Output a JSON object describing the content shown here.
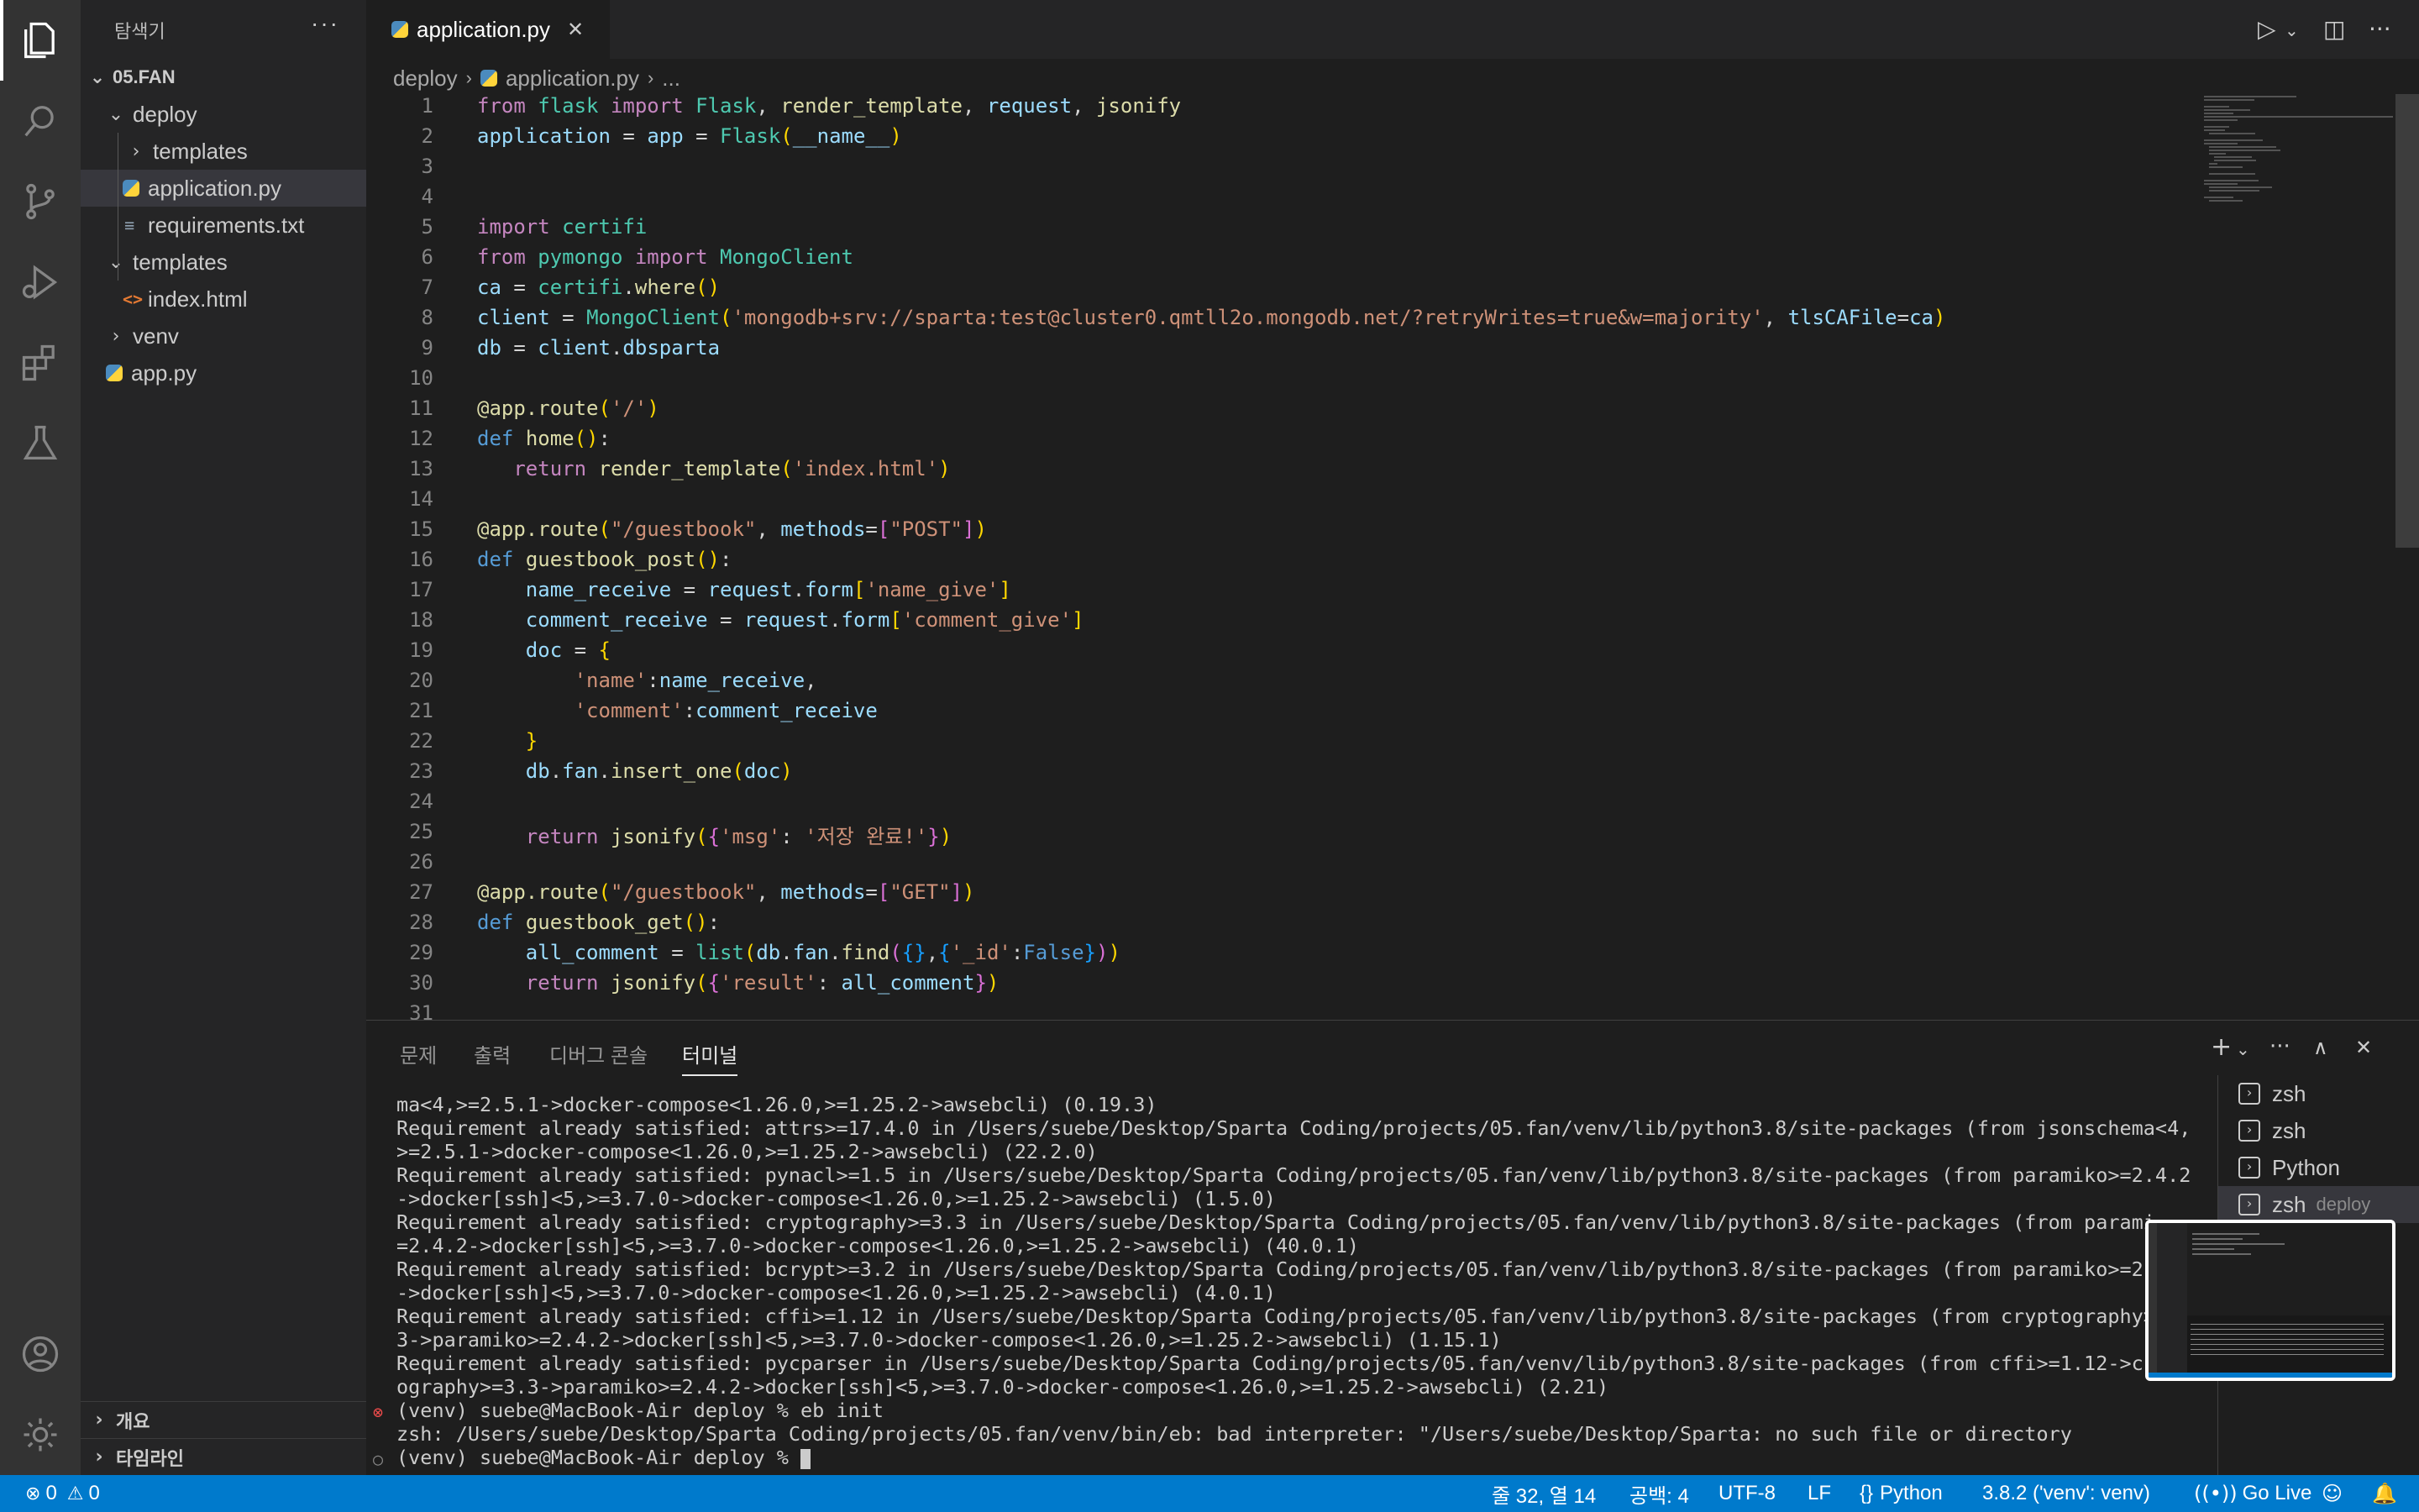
{
  "sidebar": {
    "title": "탐색기",
    "more": "···",
    "root": "05.FAN",
    "items": [
      {
        "label": "deploy"
      },
      {
        "label": "templates"
      },
      {
        "label": "application.py"
      },
      {
        "label": "requirements.txt"
      },
      {
        "label": "templates"
      },
      {
        "label": "index.html"
      },
      {
        "label": "venv"
      },
      {
        "label": "app.py"
      }
    ],
    "outline": "개요",
    "timeline": "타임라인"
  },
  "tab": {
    "label": "application.py",
    "close": "✕"
  },
  "breadcrumb": {
    "folder": "deploy",
    "file": "application.py",
    "ellipsis": "..."
  },
  "editor": {
    "line_numbers": [
      "1",
      "2",
      "3",
      "4",
      "5",
      "6",
      "7",
      "8",
      "9",
      "10",
      "11",
      "12",
      "13",
      "14",
      "15",
      "16",
      "17",
      "18",
      "19",
      "20",
      "21",
      "22",
      "23",
      "24",
      "25",
      "26",
      "27",
      "28",
      "29",
      "30",
      "31"
    ],
    "mongo_url": "'mongodb+srv://sparta:test@cluster0.qmtll2o.mongodb.net/?retryWrites=true&w=majority'",
    "save_msg": "'저장 완료!'"
  },
  "panel": {
    "tabs": [
      "문제",
      "출력",
      "디버그 콘솔",
      "터미널"
    ],
    "active_tab": "터미널",
    "terminal_lines": [
      "ma<4,>=2.5.1->docker-compose<1.26.0,>=1.25.2->awsebcli) (0.19.3)",
      "Requirement already satisfied: attrs>=17.4.0 in /Users/suebe/Desktop/Sparta Coding/projects/05.fan/venv/lib/python3.8/site-packages (from jsonschema<4,",
      ">=2.5.1->docker-compose<1.26.0,>=1.25.2->awsebcli) (22.2.0)",
      "Requirement already satisfied: pynacl>=1.5 in /Users/suebe/Desktop/Sparta Coding/projects/05.fan/venv/lib/python3.8/site-packages (from paramiko>=2.4.2",
      "->docker[ssh]<5,>=3.7.0->docker-compose<1.26.0,>=1.25.2->awsebcli) (1.5.0)",
      "Requirement already satisfied: cryptography>=3.3 in /Users/suebe/Desktop/Sparta Coding/projects/05.fan/venv/lib/python3.8/site-packages (from parami",
      "=2.4.2->docker[ssh]<5,>=3.7.0->docker-compose<1.26.0,>=1.25.2->awsebcli) (40.0.1)",
      "Requirement already satisfied: bcrypt>=3.2 in /Users/suebe/Desktop/Sparta Coding/projects/05.fan/venv/lib/python3.8/site-packages (from paramiko>=2.",
      "->docker[ssh]<5,>=3.7.0->docker-compose<1.26.0,>=1.25.2->awsebcli) (4.0.1)",
      "Requirement already satisfied: cffi>=1.12 in /Users/suebe/Desktop/Sparta Coding/projects/05.fan/venv/lib/python3.8/site-packages (from cryptography>=",
      "3->paramiko>=2.4.2->docker[ssh]<5,>=3.7.0->docker-compose<1.26.0,>=1.25.2->awsebcli) (1.15.1)",
      "Requirement already satisfied: pycparser in /Users/suebe/Desktop/Sparta Coding/projects/05.fan/venv/lib/python3.8/site-packages (from cffi>=1.12->cr",
      "ography>=3.3->paramiko>=2.4.2->docker[ssh]<5,>=3.7.0->docker-compose<1.26.0,>=1.25.2->awsebcli) (2.21)",
      "(venv) suebe@MacBook-Air deploy % eb init",
      "zsh: /Users/suebe/Desktop/Sparta Coding/projects/05.fan/venv/bin/eb: bad interpreter: \"/Users/suebe/Desktop/Sparta: no such file or directory",
      "(venv) suebe@MacBook-Air deploy % "
    ],
    "terminals": [
      {
        "label": "zsh",
        "sub": ""
      },
      {
        "label": "zsh",
        "sub": ""
      },
      {
        "label": "Python",
        "sub": ""
      },
      {
        "label": "zsh",
        "sub": "deploy"
      }
    ]
  },
  "status": {
    "errors": "0",
    "warnings": "0",
    "position": "줄 32, 열 14",
    "indent": "공백: 4",
    "encoding": "UTF-8",
    "eol": "LF",
    "language": "Python",
    "interpreter": "3.8.2 ('venv': venv)",
    "golive": "Go Live"
  },
  "colors": {
    "statusbar": "#007acc",
    "activitybar": "#333333",
    "sidebar": "#252526",
    "editor": "#1e1e1e"
  }
}
